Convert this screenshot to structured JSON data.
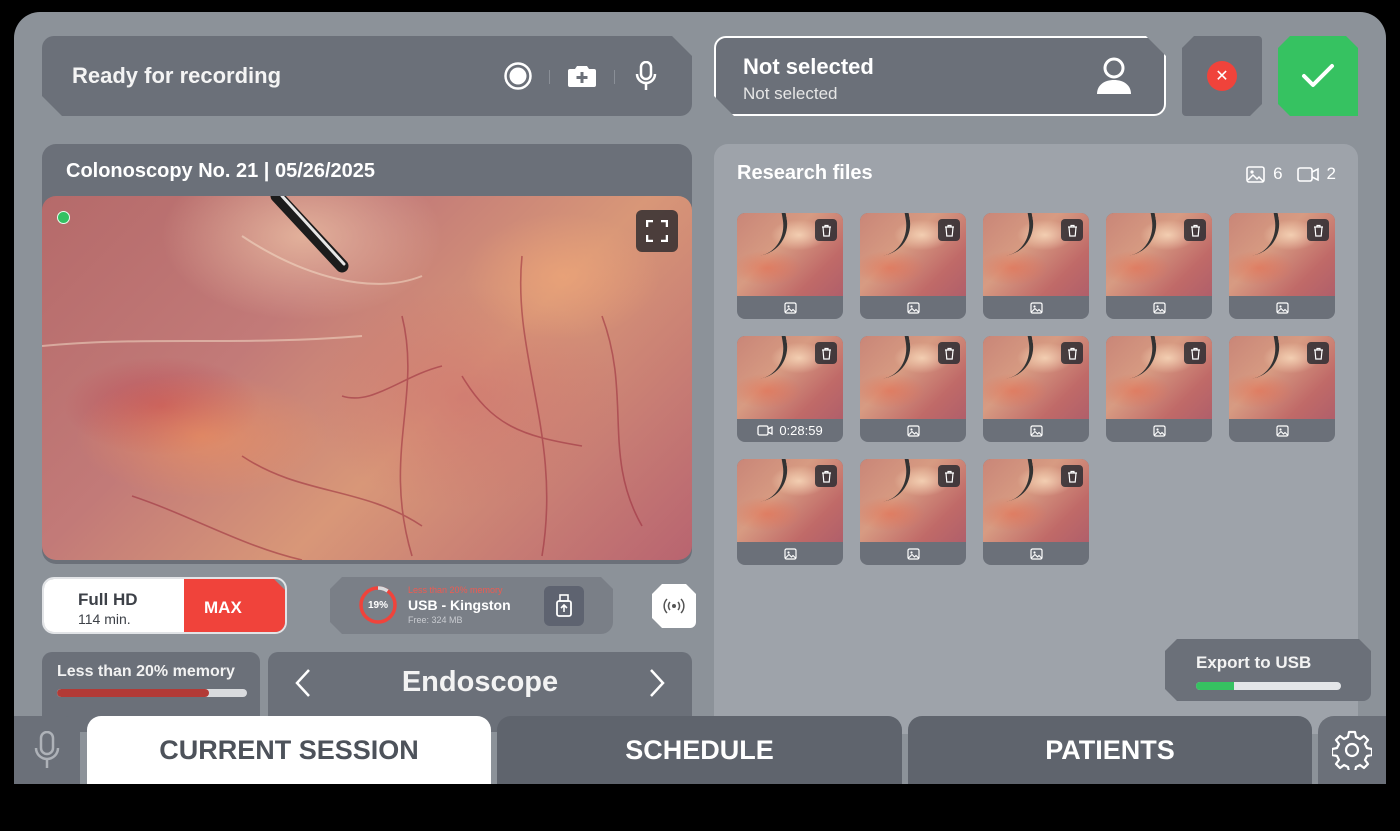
{
  "recording": {
    "status": "Ready for recording"
  },
  "patient": {
    "name": "Not selected",
    "subtitle": "Not selected"
  },
  "video": {
    "title": "Colonoscopy No. 21 | 05/26/2025"
  },
  "quality": {
    "resolution": "Full HD",
    "minutes": "114 min.",
    "max_label": "MAX"
  },
  "usb": {
    "percent": "19%",
    "percent_value": 0.19,
    "warning": "Less than 20% memory",
    "name": "USB - Kingston",
    "free": "Free: 324 MB"
  },
  "memory": {
    "label": "Less than 20% memory",
    "fill_fraction": 0.8
  },
  "source": {
    "name": "Endoscope"
  },
  "research": {
    "title": "Research files",
    "image_count": "6",
    "video_count": "2",
    "files": [
      {
        "type": "image",
        "label": ""
      },
      {
        "type": "image",
        "label": ""
      },
      {
        "type": "image",
        "label": ""
      },
      {
        "type": "image",
        "label": ""
      },
      {
        "type": "image",
        "label": ""
      },
      {
        "type": "video",
        "label": "0:28:59"
      },
      {
        "type": "image",
        "label": ""
      },
      {
        "type": "image",
        "label": ""
      },
      {
        "type": "image",
        "label": ""
      },
      {
        "type": "image",
        "label": ""
      },
      {
        "type": "image",
        "label": ""
      },
      {
        "type": "image",
        "label": ""
      },
      {
        "type": "image",
        "label": ""
      }
    ]
  },
  "export": {
    "label": "Export to USB",
    "progress_fraction": 0.26
  },
  "tabs": {
    "current": "CURRENT SESSION",
    "schedule": "SCHEDULE",
    "patients": "PATIENTS"
  },
  "colors": {
    "accent_green": "#36c261",
    "alert_red": "#f0433b",
    "panel": "#6b7079",
    "background": "#8c9299"
  }
}
